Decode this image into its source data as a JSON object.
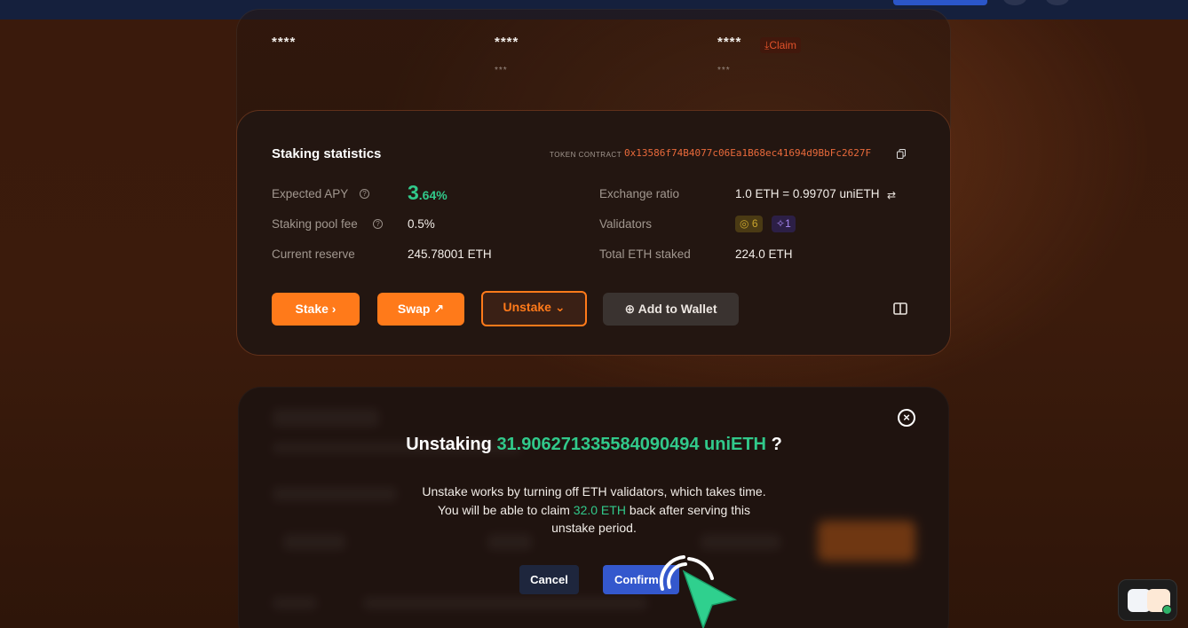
{
  "colors": {
    "accent": "#ff7a1a",
    "green": "#31c98b",
    "contract": "#e96a3b",
    "confirm": "#3458cd"
  },
  "top_rewards": {
    "col1": {
      "value": "****"
    },
    "col2": {
      "value": "****",
      "sub": "***"
    },
    "col3": {
      "value": "****",
      "sub": "***",
      "claim_label": "Claim"
    }
  },
  "stats": {
    "title": "Staking statistics",
    "token_contract_label": "TOKEN CONTRACT",
    "token_contract_value": "0x13586f74B4077c06Ea1B68ec41694d9BbFc2627F",
    "expected_apy_label": "Expected APY",
    "apy_int": "3",
    "apy_frac": ".64%",
    "fee_label": "Staking pool fee",
    "fee_value": "0.5%",
    "reserve_label": "Current reserve",
    "reserve_value": "245.78001 ETH",
    "exchange_label": "Exchange ratio",
    "exchange_value": "1.0 ETH = 0.99707 uniETH",
    "validators_label": "Validators",
    "validators_badge1": "6",
    "validators_badge2": "1",
    "total_label": "Total ETH staked",
    "total_value": "224.0 ETH"
  },
  "actions": {
    "stake": "Stake",
    "swap": "Swap",
    "unstake": "Unstake",
    "add_wallet": "Add to Wallet"
  },
  "modal": {
    "title_prefix": "Unstaking",
    "amount": "31.906271335584090494 uniETH",
    "title_suffix": "?",
    "body_part1": "Unstake works by turning off ETH validators, which takes time. You will be able to claim",
    "claim_amount": "32.0 ETH",
    "body_part2": "back after serving this unstake period.",
    "cancel": "Cancel",
    "confirm": "Confirm"
  }
}
